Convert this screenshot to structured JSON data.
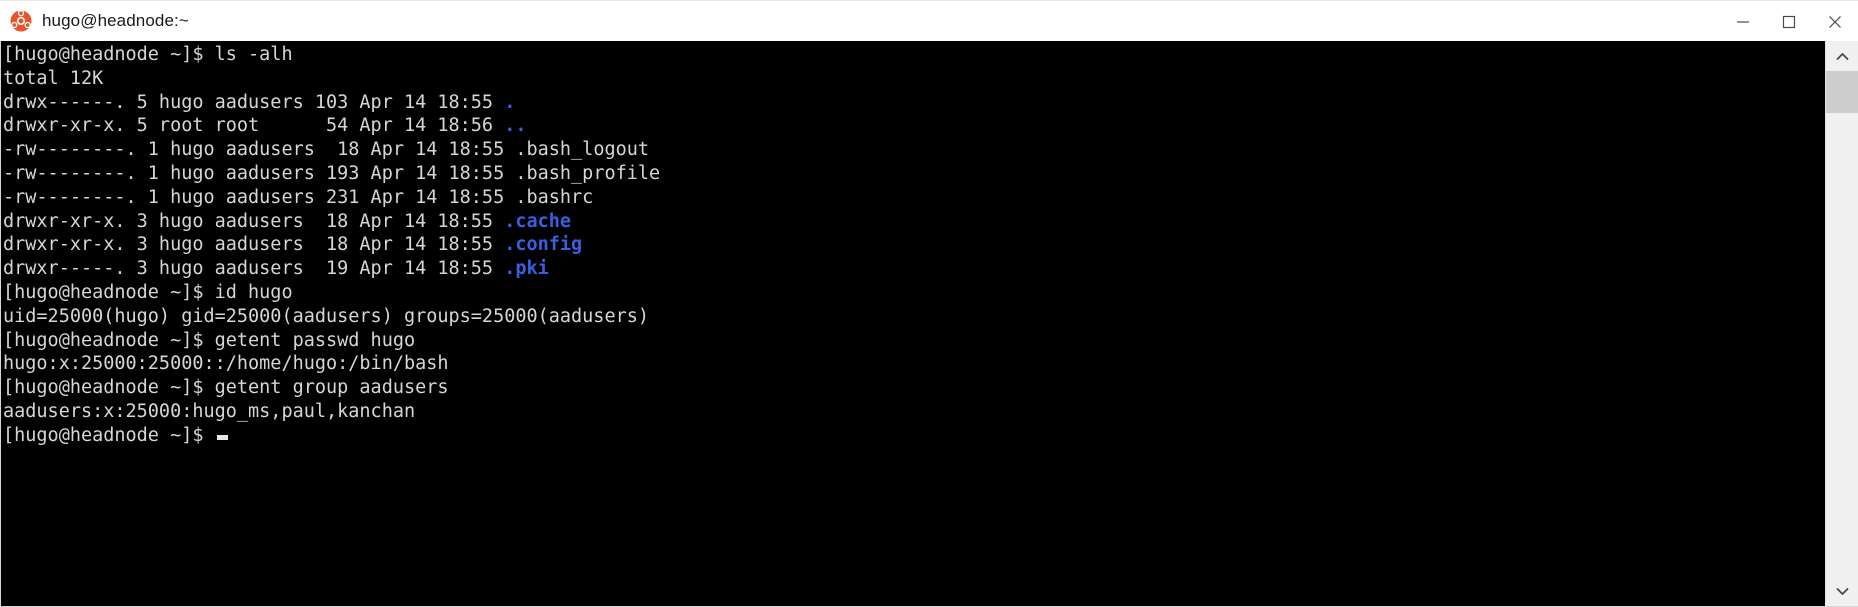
{
  "window": {
    "title": "hugo@headnode:~",
    "app_icon": "ubuntu-logo-icon",
    "controls": {
      "minimize_label": "Minimize",
      "maximize_label": "Maximize",
      "close_label": "Close"
    }
  },
  "terminal": {
    "background_color": "#000000",
    "foreground_color": "#d6d6d6",
    "directory_color": "#3a5fe0",
    "prompt": "[hugo@headnode ~]$",
    "lines": [
      {
        "id": "cmd-ls",
        "text": "[hugo@headnode ~]$ ls -alh",
        "type": "command"
      },
      {
        "id": "out-total",
        "text": "total 12K",
        "type": "output"
      },
      {
        "id": "ls-dot",
        "prefix": "drwx------. 5 hugo aadusers 103 Apr 14 18:55 ",
        "name": ".",
        "type": "dir"
      },
      {
        "id": "ls-dotdot",
        "prefix": "drwxr-xr-x. 5 root root      54 Apr 14 18:56 ",
        "name": "..",
        "type": "dir"
      },
      {
        "id": "ls-bash-logout",
        "prefix": "-rw--------. 1 hugo aadusers  18 Apr 14 18:55 ",
        "name": ".bash_logout",
        "type": "file"
      },
      {
        "id": "ls-bash-profile",
        "prefix": "-rw--------. 1 hugo aadusers 193 Apr 14 18:55 ",
        "name": ".bash_profile",
        "type": "file"
      },
      {
        "id": "ls-bashrc",
        "prefix": "-rw--------. 1 hugo aadusers 231 Apr 14 18:55 ",
        "name": ".bashrc",
        "type": "file"
      },
      {
        "id": "ls-cache",
        "prefix": "drwxr-xr-x. 3 hugo aadusers  18 Apr 14 18:55 ",
        "name": ".cache",
        "type": "dir"
      },
      {
        "id": "ls-config",
        "prefix": "drwxr-xr-x. 3 hugo aadusers  18 Apr 14 18:55 ",
        "name": ".config",
        "type": "dir"
      },
      {
        "id": "ls-pki",
        "prefix": "drwxr-----. 3 hugo aadusers  19 Apr 14 18:55 ",
        "name": ".pki",
        "type": "dir"
      },
      {
        "id": "cmd-id",
        "text": "[hugo@headnode ~]$ id hugo",
        "type": "command"
      },
      {
        "id": "out-id",
        "text": "uid=25000(hugo) gid=25000(aadusers) groups=25000(aadusers)",
        "type": "output"
      },
      {
        "id": "cmd-getent-passwd",
        "text": "[hugo@headnode ~]$ getent passwd hugo",
        "type": "command"
      },
      {
        "id": "out-getent-passwd",
        "text": "hugo:x:25000:25000::/home/hugo:/bin/bash",
        "type": "output"
      },
      {
        "id": "cmd-getent-group",
        "text": "[hugo@headnode ~]$ getent group aadusers",
        "type": "command"
      },
      {
        "id": "out-getent-group",
        "text": "aadusers:x:25000:hugo_ms,paul,kanchan",
        "type": "output"
      },
      {
        "id": "prompt-final",
        "text": "[hugo@headnode ~]$ ",
        "type": "prompt-cursor"
      }
    ]
  },
  "scrollbar": {
    "up_arrow": "chevron-up-icon",
    "down_arrow": "chevron-down-icon",
    "thumb_position": "top"
  }
}
